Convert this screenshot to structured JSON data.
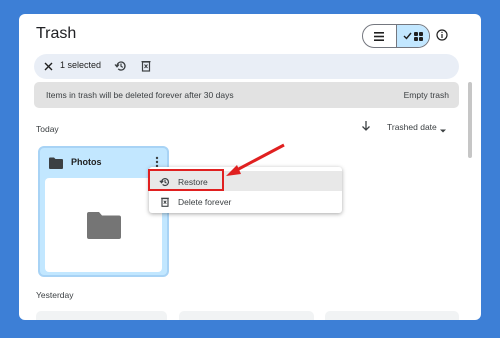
{
  "header": {
    "title": "Trash"
  },
  "icons": {
    "list": "list-view-icon",
    "grid": "grid-view-icon",
    "check": "check-icon",
    "info": "info-icon",
    "close": "close-icon",
    "restore": "restore-icon",
    "delete": "delete-icon",
    "sort": "arrow-down-icon",
    "caret": "caret-down-icon",
    "folder": "folder-icon",
    "more": "more-vert-icon"
  },
  "selection": {
    "count_label": "1 selected"
  },
  "banner": {
    "message": "Items in trash will be deleted forever after 30 days",
    "action": "Empty trash"
  },
  "sections": {
    "today": "Today",
    "yesterday": "Yesterday"
  },
  "sort": {
    "label": "Trashed date"
  },
  "card": {
    "name": "Photos"
  },
  "context_menu": {
    "items": [
      {
        "label": "Restore",
        "icon": "restore-icon"
      },
      {
        "label": "Delete forever",
        "icon": "delete-icon"
      }
    ]
  },
  "colors": {
    "background": "#3d7fd6",
    "selected": "#c2e7ff",
    "annotation": "#e02020"
  }
}
